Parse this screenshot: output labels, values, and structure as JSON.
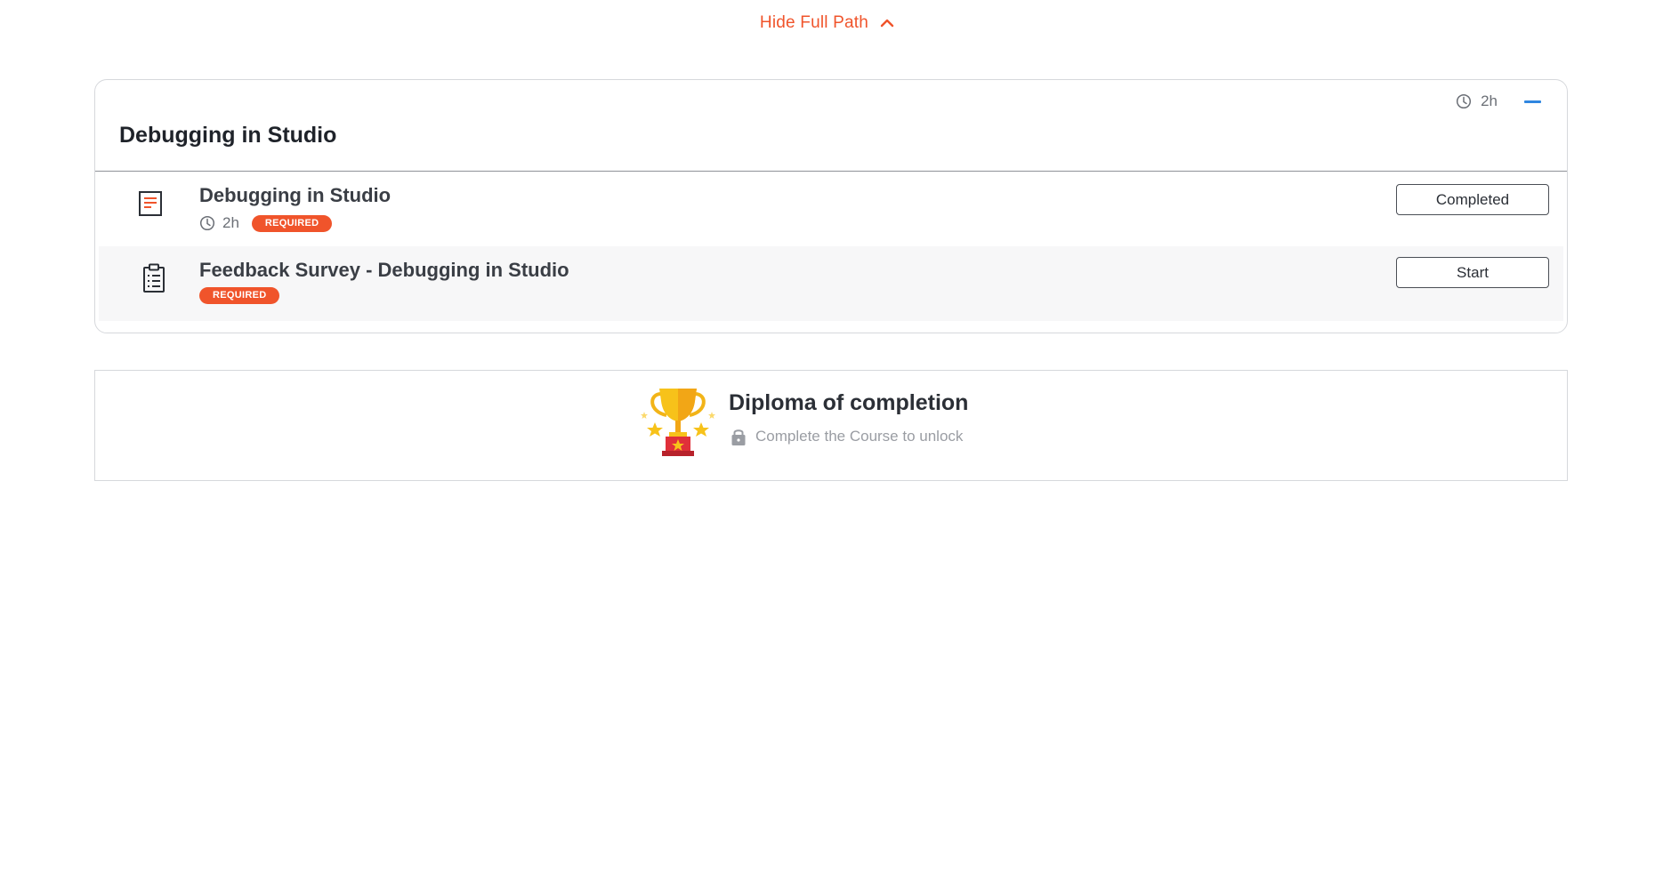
{
  "path_toggle": {
    "label": "Hide Full Path",
    "icon": "chevron-up-icon",
    "color": "#f0542b"
  },
  "module": {
    "title": "Debugging in Studio",
    "duration": "2h",
    "collapse_icon": "minus-icon",
    "lessons": [
      {
        "title": "Debugging in Studio",
        "icon": "document-icon",
        "duration": "2h",
        "badge": "REQUIRED",
        "action": "Completed"
      },
      {
        "title": "Feedback Survey - Debugging in Studio",
        "icon": "clipboard-icon",
        "badge": "REQUIRED",
        "action": "Start"
      }
    ]
  },
  "diploma": {
    "title": "Diploma of completion",
    "subtitle": "Complete the Course to unlock",
    "icon": "trophy-icon",
    "lock_icon": "lock-icon"
  },
  "colors": {
    "accent": "#f0542b",
    "collapse": "#2f86e0"
  }
}
